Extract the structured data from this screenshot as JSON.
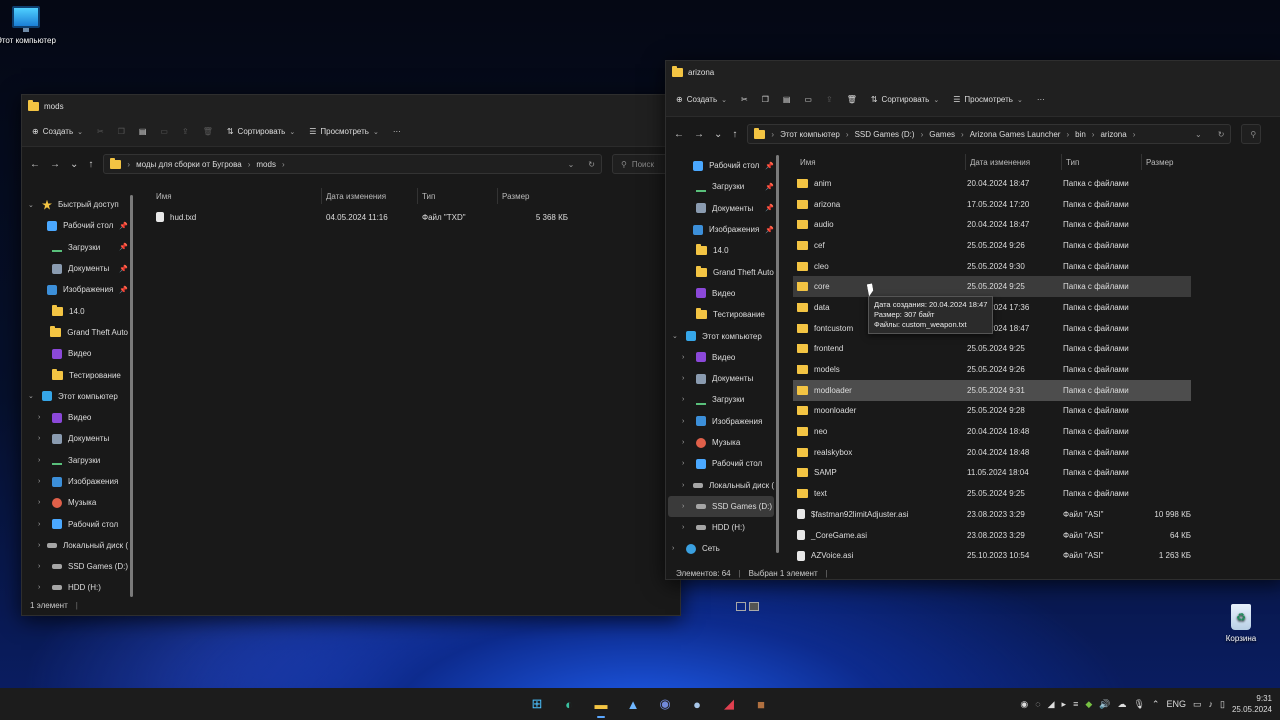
{
  "desktop": {
    "this_pc_label": "Этот компьютер",
    "recycle_label": "Корзина"
  },
  "win_left": {
    "title": "mods",
    "toolbar": {
      "create": "Создать",
      "sort": "Сортировать",
      "view": "Просмотреть",
      "more": "···"
    },
    "address": [
      "моды для сборки от Бугрова",
      "mods"
    ],
    "search_placeholder": "Поиск",
    "nav": [
      {
        "label": "Быстрый доступ",
        "icon": "star",
        "indent": 0,
        "expand": "⌄",
        "pin": false
      },
      {
        "label": "Рабочий стол",
        "icon": "desk",
        "indent": 1,
        "expand": "",
        "pin": true
      },
      {
        "label": "Загрузки",
        "icon": "down",
        "indent": 1,
        "expand": "",
        "pin": true
      },
      {
        "label": "Документы",
        "icon": "doc",
        "indent": 1,
        "expand": "",
        "pin": true
      },
      {
        "label": "Изображения",
        "icon": "img",
        "indent": 1,
        "expand": "",
        "pin": true
      },
      {
        "label": "14.0",
        "icon": "folder",
        "indent": 1,
        "expand": "",
        "pin": false
      },
      {
        "label": "Grand Theft Auto",
        "icon": "folder",
        "indent": 1,
        "expand": "",
        "pin": false
      },
      {
        "label": "Видео",
        "icon": "vid",
        "indent": 1,
        "expand": "",
        "pin": false
      },
      {
        "label": "Тестирование",
        "icon": "folder",
        "indent": 1,
        "expand": "",
        "pin": false
      },
      {
        "label": "Этот компьютер",
        "icon": "pc",
        "indent": 0,
        "expand": "⌄",
        "pin": false
      },
      {
        "label": "Видео",
        "icon": "vid",
        "indent": 1,
        "expand": "›",
        "pin": false
      },
      {
        "label": "Документы",
        "icon": "doc",
        "indent": 1,
        "expand": "›",
        "pin": false
      },
      {
        "label": "Загрузки",
        "icon": "down",
        "indent": 1,
        "expand": "›",
        "pin": false
      },
      {
        "label": "Изображения",
        "icon": "img",
        "indent": 1,
        "expand": "›",
        "pin": false
      },
      {
        "label": "Музыка",
        "icon": "mus",
        "indent": 1,
        "expand": "›",
        "pin": false
      },
      {
        "label": "Рабочий стол",
        "icon": "desk",
        "indent": 1,
        "expand": "›",
        "pin": false
      },
      {
        "label": "Локальный диск (",
        "icon": "drive",
        "indent": 1,
        "expand": "›",
        "pin": false
      },
      {
        "label": "SSD Games (D:)",
        "icon": "drive",
        "indent": 1,
        "expand": "›",
        "pin": false
      },
      {
        "label": "HDD (H:)",
        "icon": "drive",
        "indent": 1,
        "expand": "›",
        "pin": false
      }
    ],
    "columns": {
      "name": "Имя",
      "date": "Дата изменения",
      "type": "Тип",
      "size": "Размер"
    },
    "files": [
      {
        "name": "hud.txd",
        "date": "04.05.2024 11:16",
        "type": "Файл \"TXD\"",
        "size": "5 368 КБ"
      }
    ],
    "status": "1 элемент"
  },
  "win_right": {
    "title": "arizona",
    "toolbar": {
      "create": "Создать",
      "sort": "Сортировать",
      "view": "Просмотреть",
      "more": "···"
    },
    "address": [
      "Этот компьютер",
      "SSD Games (D:)",
      "Games",
      "Arizona Games Launcher",
      "bin",
      "arizona"
    ],
    "nav": [
      {
        "label": "Рабочий стол",
        "icon": "desk",
        "indent": 1,
        "expand": "",
        "pin": true
      },
      {
        "label": "Загрузки",
        "icon": "down",
        "indent": 1,
        "expand": "",
        "pin": true
      },
      {
        "label": "Документы",
        "icon": "doc",
        "indent": 1,
        "expand": "",
        "pin": true
      },
      {
        "label": "Изображения",
        "icon": "img",
        "indent": 1,
        "expand": "",
        "pin": true
      },
      {
        "label": "14.0",
        "icon": "folder",
        "indent": 1,
        "expand": "",
        "pin": false
      },
      {
        "label": "Grand Theft Auto",
        "icon": "folder",
        "indent": 1,
        "expand": "",
        "pin": false
      },
      {
        "label": "Видео",
        "icon": "vid",
        "indent": 1,
        "expand": "",
        "pin": false
      },
      {
        "label": "Тестирование",
        "icon": "folder",
        "indent": 1,
        "expand": "",
        "pin": false
      },
      {
        "label": "Этот компьютер",
        "icon": "pc",
        "indent": 0,
        "expand": "⌄",
        "pin": false
      },
      {
        "label": "Видео",
        "icon": "vid",
        "indent": 1,
        "expand": "›",
        "pin": false
      },
      {
        "label": "Документы",
        "icon": "doc",
        "indent": 1,
        "expand": "›",
        "pin": false
      },
      {
        "label": "Загрузки",
        "icon": "down",
        "indent": 1,
        "expand": "›",
        "pin": false
      },
      {
        "label": "Изображения",
        "icon": "img",
        "indent": 1,
        "expand": "›",
        "pin": false
      },
      {
        "label": "Музыка",
        "icon": "mus",
        "indent": 1,
        "expand": "›",
        "pin": false
      },
      {
        "label": "Рабочий стол",
        "icon": "desk",
        "indent": 1,
        "expand": "›",
        "pin": false
      },
      {
        "label": "Локальный диск (",
        "icon": "drive",
        "indent": 1,
        "expand": "›",
        "pin": false
      },
      {
        "label": "SSD Games (D:)",
        "icon": "drive",
        "indent": 1,
        "expand": "›",
        "pin": false,
        "selected": true
      },
      {
        "label": "HDD (H:)",
        "icon": "drive",
        "indent": 1,
        "expand": "›",
        "pin": false
      },
      {
        "label": "Сеть",
        "icon": "net",
        "indent": 0,
        "expand": "›",
        "pin": false
      }
    ],
    "columns": {
      "name": "Имя",
      "date": "Дата изменения",
      "type": "Тип",
      "size": "Размер"
    },
    "files": [
      {
        "name": "anim",
        "date": "20.04.2024 18:47",
        "type": "Папка с файлами",
        "size": "",
        "kind": "folder"
      },
      {
        "name": "arizona",
        "date": "17.05.2024 17:20",
        "type": "Папка с файлами",
        "size": "",
        "kind": "folder"
      },
      {
        "name": "audio",
        "date": "20.04.2024 18:47",
        "type": "Папка с файлами",
        "size": "",
        "kind": "folder"
      },
      {
        "name": "cef",
        "date": "25.05.2024 9:26",
        "type": "Папка с файлами",
        "size": "",
        "kind": "folder"
      },
      {
        "name": "cleo",
        "date": "25.05.2024 9:30",
        "type": "Папка с файлами",
        "size": "",
        "kind": "folder"
      },
      {
        "name": "core",
        "date": "25.05.2024 9:25",
        "type": "Папка с файлами",
        "size": "",
        "kind": "folder",
        "state": "hover"
      },
      {
        "name": "data",
        "date": "25.05.2024 17:36",
        "type": "Папка с файлами",
        "size": "",
        "kind": "folder"
      },
      {
        "name": "fontcustom",
        "date": "20.04.2024 18:47",
        "type": "Папка с файлами",
        "size": "",
        "kind": "folder"
      },
      {
        "name": "frontend",
        "date": "25.05.2024 9:25",
        "type": "Папка с файлами",
        "size": "",
        "kind": "folder"
      },
      {
        "name": "models",
        "date": "25.05.2024 9:26",
        "type": "Папка с файлами",
        "size": "",
        "kind": "folder"
      },
      {
        "name": "modloader",
        "date": "25.05.2024 9:31",
        "type": "Папка с файлами",
        "size": "",
        "kind": "folder",
        "state": "sel"
      },
      {
        "name": "moonloader",
        "date": "25.05.2024 9:28",
        "type": "Папка с файлами",
        "size": "",
        "kind": "folder"
      },
      {
        "name": "neo",
        "date": "20.04.2024 18:48",
        "type": "Папка с файлами",
        "size": "",
        "kind": "folder"
      },
      {
        "name": "realskybox",
        "date": "20.04.2024 18:48",
        "type": "Папка с файлами",
        "size": "",
        "kind": "folder"
      },
      {
        "name": "SAMP",
        "date": "11.05.2024 18:04",
        "type": "Папка с файлами",
        "size": "",
        "kind": "folder"
      },
      {
        "name": "text",
        "date": "25.05.2024 9:25",
        "type": "Папка с файлами",
        "size": "",
        "kind": "folder"
      },
      {
        "name": "$fastman92limitAdjuster.asi",
        "date": "23.08.2023 3:29",
        "type": "Файл \"ASI\"",
        "size": "10 998 КБ",
        "kind": "file"
      },
      {
        "name": "_CoreGame.asi",
        "date": "23.08.2023 3:29",
        "type": "Файл \"ASI\"",
        "size": "64 КБ",
        "kind": "file"
      },
      {
        "name": "AZVoice.asi",
        "date": "25.10.2023 10:54",
        "type": "Файл \"ASI\"",
        "size": "1 263 КБ",
        "kind": "file"
      }
    ],
    "tooltip": [
      "Дата создания: 20.04.2024 18:47",
      "Размер: 307 байт",
      "Файлы: custom_weapon.txt"
    ],
    "status_count": "Элементов: 64",
    "status_selected": "Выбран 1 элемент"
  },
  "taskbar": {
    "apps": [
      {
        "name": "start",
        "glyph": "⊞",
        "color": "#4cc2ff",
        "active": false
      },
      {
        "name": "edge",
        "glyph": "◐",
        "color": "#3ac0a0",
        "active": false
      },
      {
        "name": "explorer",
        "glyph": "▬",
        "color": "#f3c443",
        "active": true
      },
      {
        "name": "photos",
        "glyph": "▲",
        "color": "#6fb7ff",
        "active": false
      },
      {
        "name": "discord",
        "glyph": "◉",
        "color": "#7289da",
        "active": false
      },
      {
        "name": "steam",
        "glyph": "●",
        "color": "#a8c6e8",
        "active": false
      },
      {
        "name": "launcher",
        "glyph": "◢",
        "color": "#e04050",
        "active": false
      },
      {
        "name": "game",
        "glyph": "■",
        "color": "#b07040",
        "active": false
      }
    ],
    "lang": "ENG",
    "time": "9:31",
    "date": "25.05.2024"
  }
}
